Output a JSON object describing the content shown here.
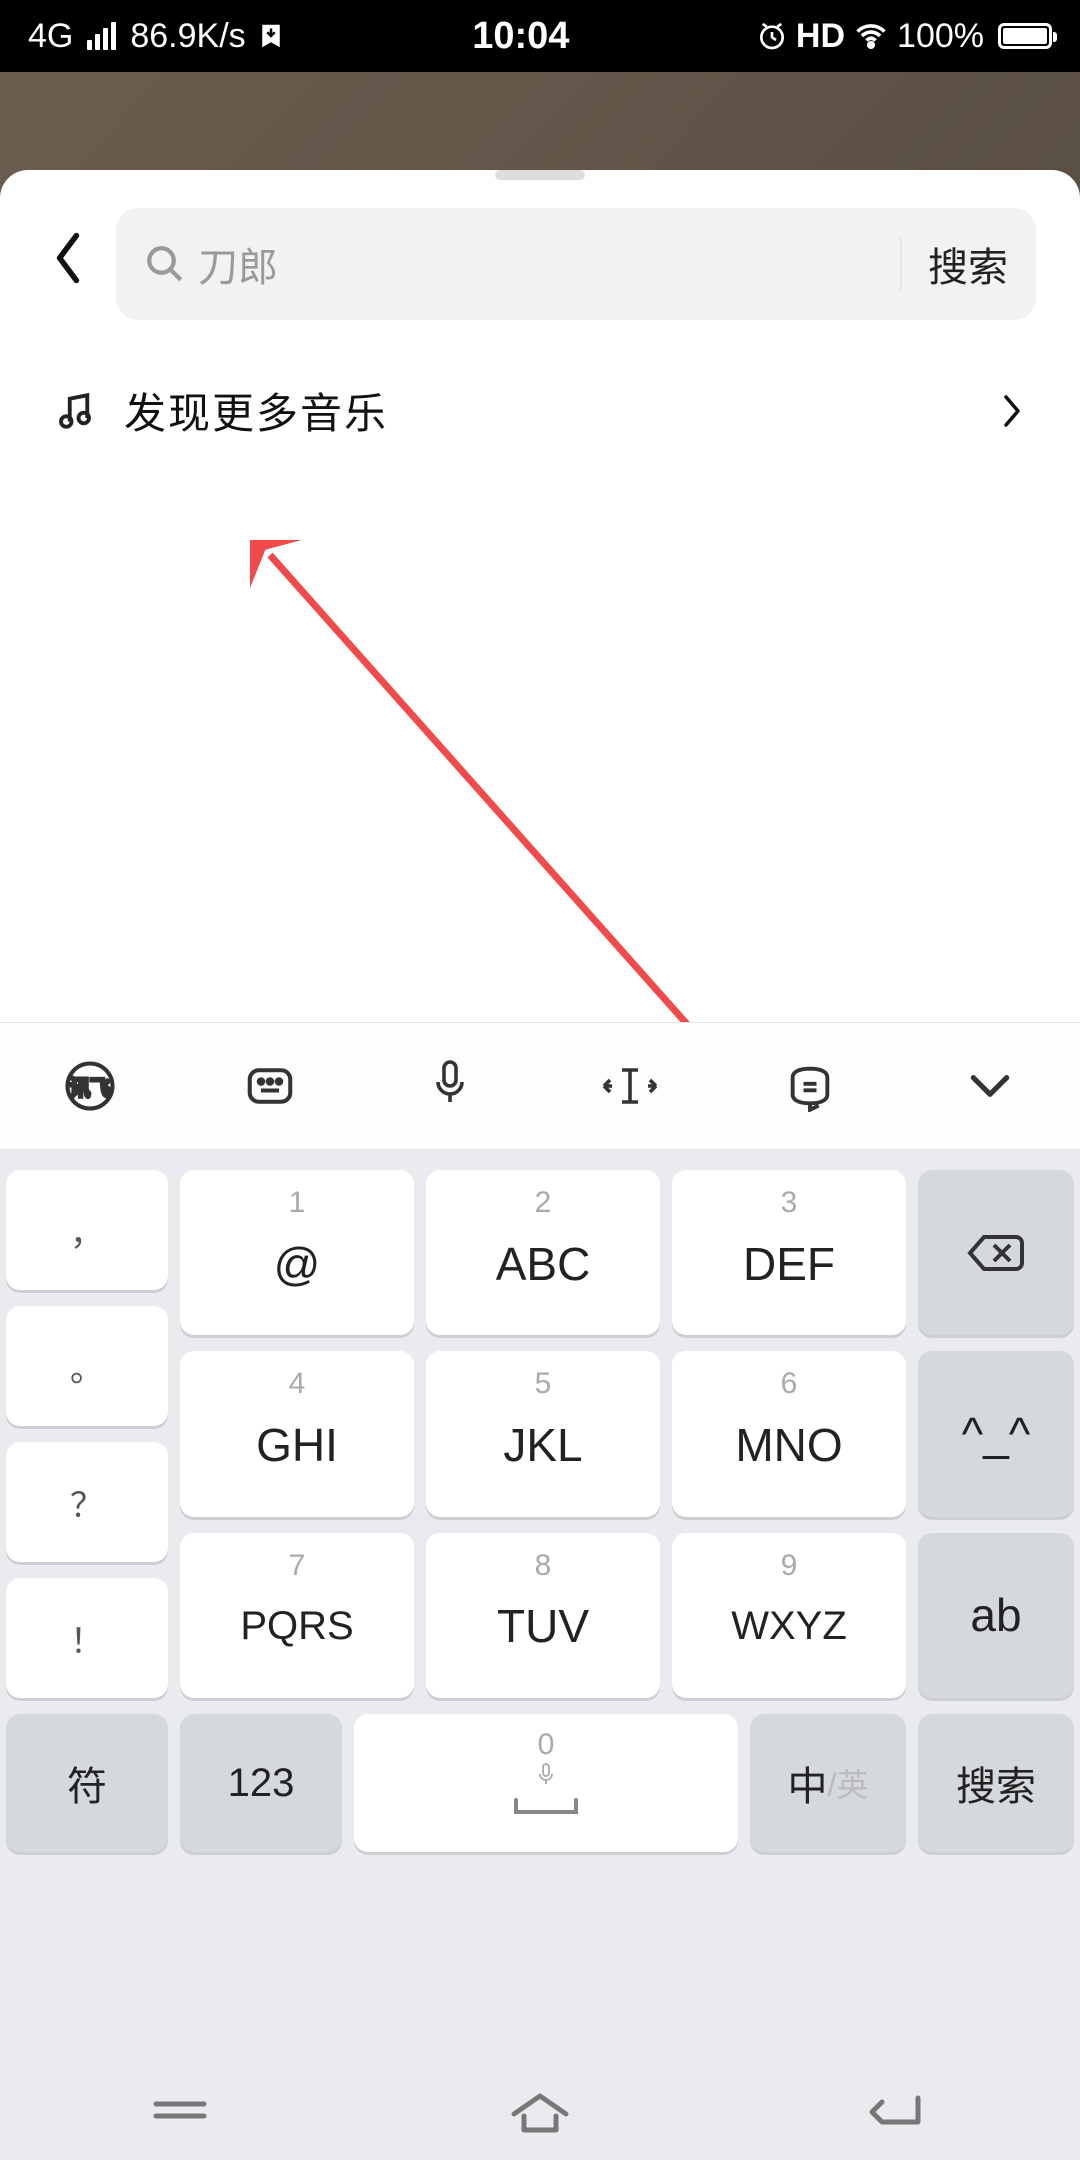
{
  "statusbar": {
    "network": "4G",
    "speed": "86.9K/s",
    "clock": "10:04",
    "hd": "HD",
    "battery_pct": "100%"
  },
  "search": {
    "placeholder": "刀郎",
    "button": "搜索"
  },
  "discover": {
    "label": "发现更多音乐"
  },
  "keyboard": {
    "punct": {
      "comma": "，",
      "period": "。",
      "question": "？",
      "bang": "！"
    },
    "keys": {
      "k1": {
        "num": "1",
        "main": "@"
      },
      "k2": {
        "num": "2",
        "main": "ABC"
      },
      "k3": {
        "num": "3",
        "main": "DEF"
      },
      "k4": {
        "num": "4",
        "main": "GHI"
      },
      "k5": {
        "num": "5",
        "main": "JKL"
      },
      "k6": {
        "num": "6",
        "main": "MNO"
      },
      "k7": {
        "num": "7",
        "main": "PQRS"
      },
      "k8": {
        "num": "8",
        "main": "TUV"
      },
      "k9": {
        "num": "9",
        "main": "WXYZ"
      },
      "emoji": "^_^",
      "ab": "ab"
    },
    "bottom": {
      "sym": "符",
      "num": "123",
      "zero": "0",
      "lang_zh": "中",
      "lang_en": "/英",
      "search": "搜索"
    }
  }
}
